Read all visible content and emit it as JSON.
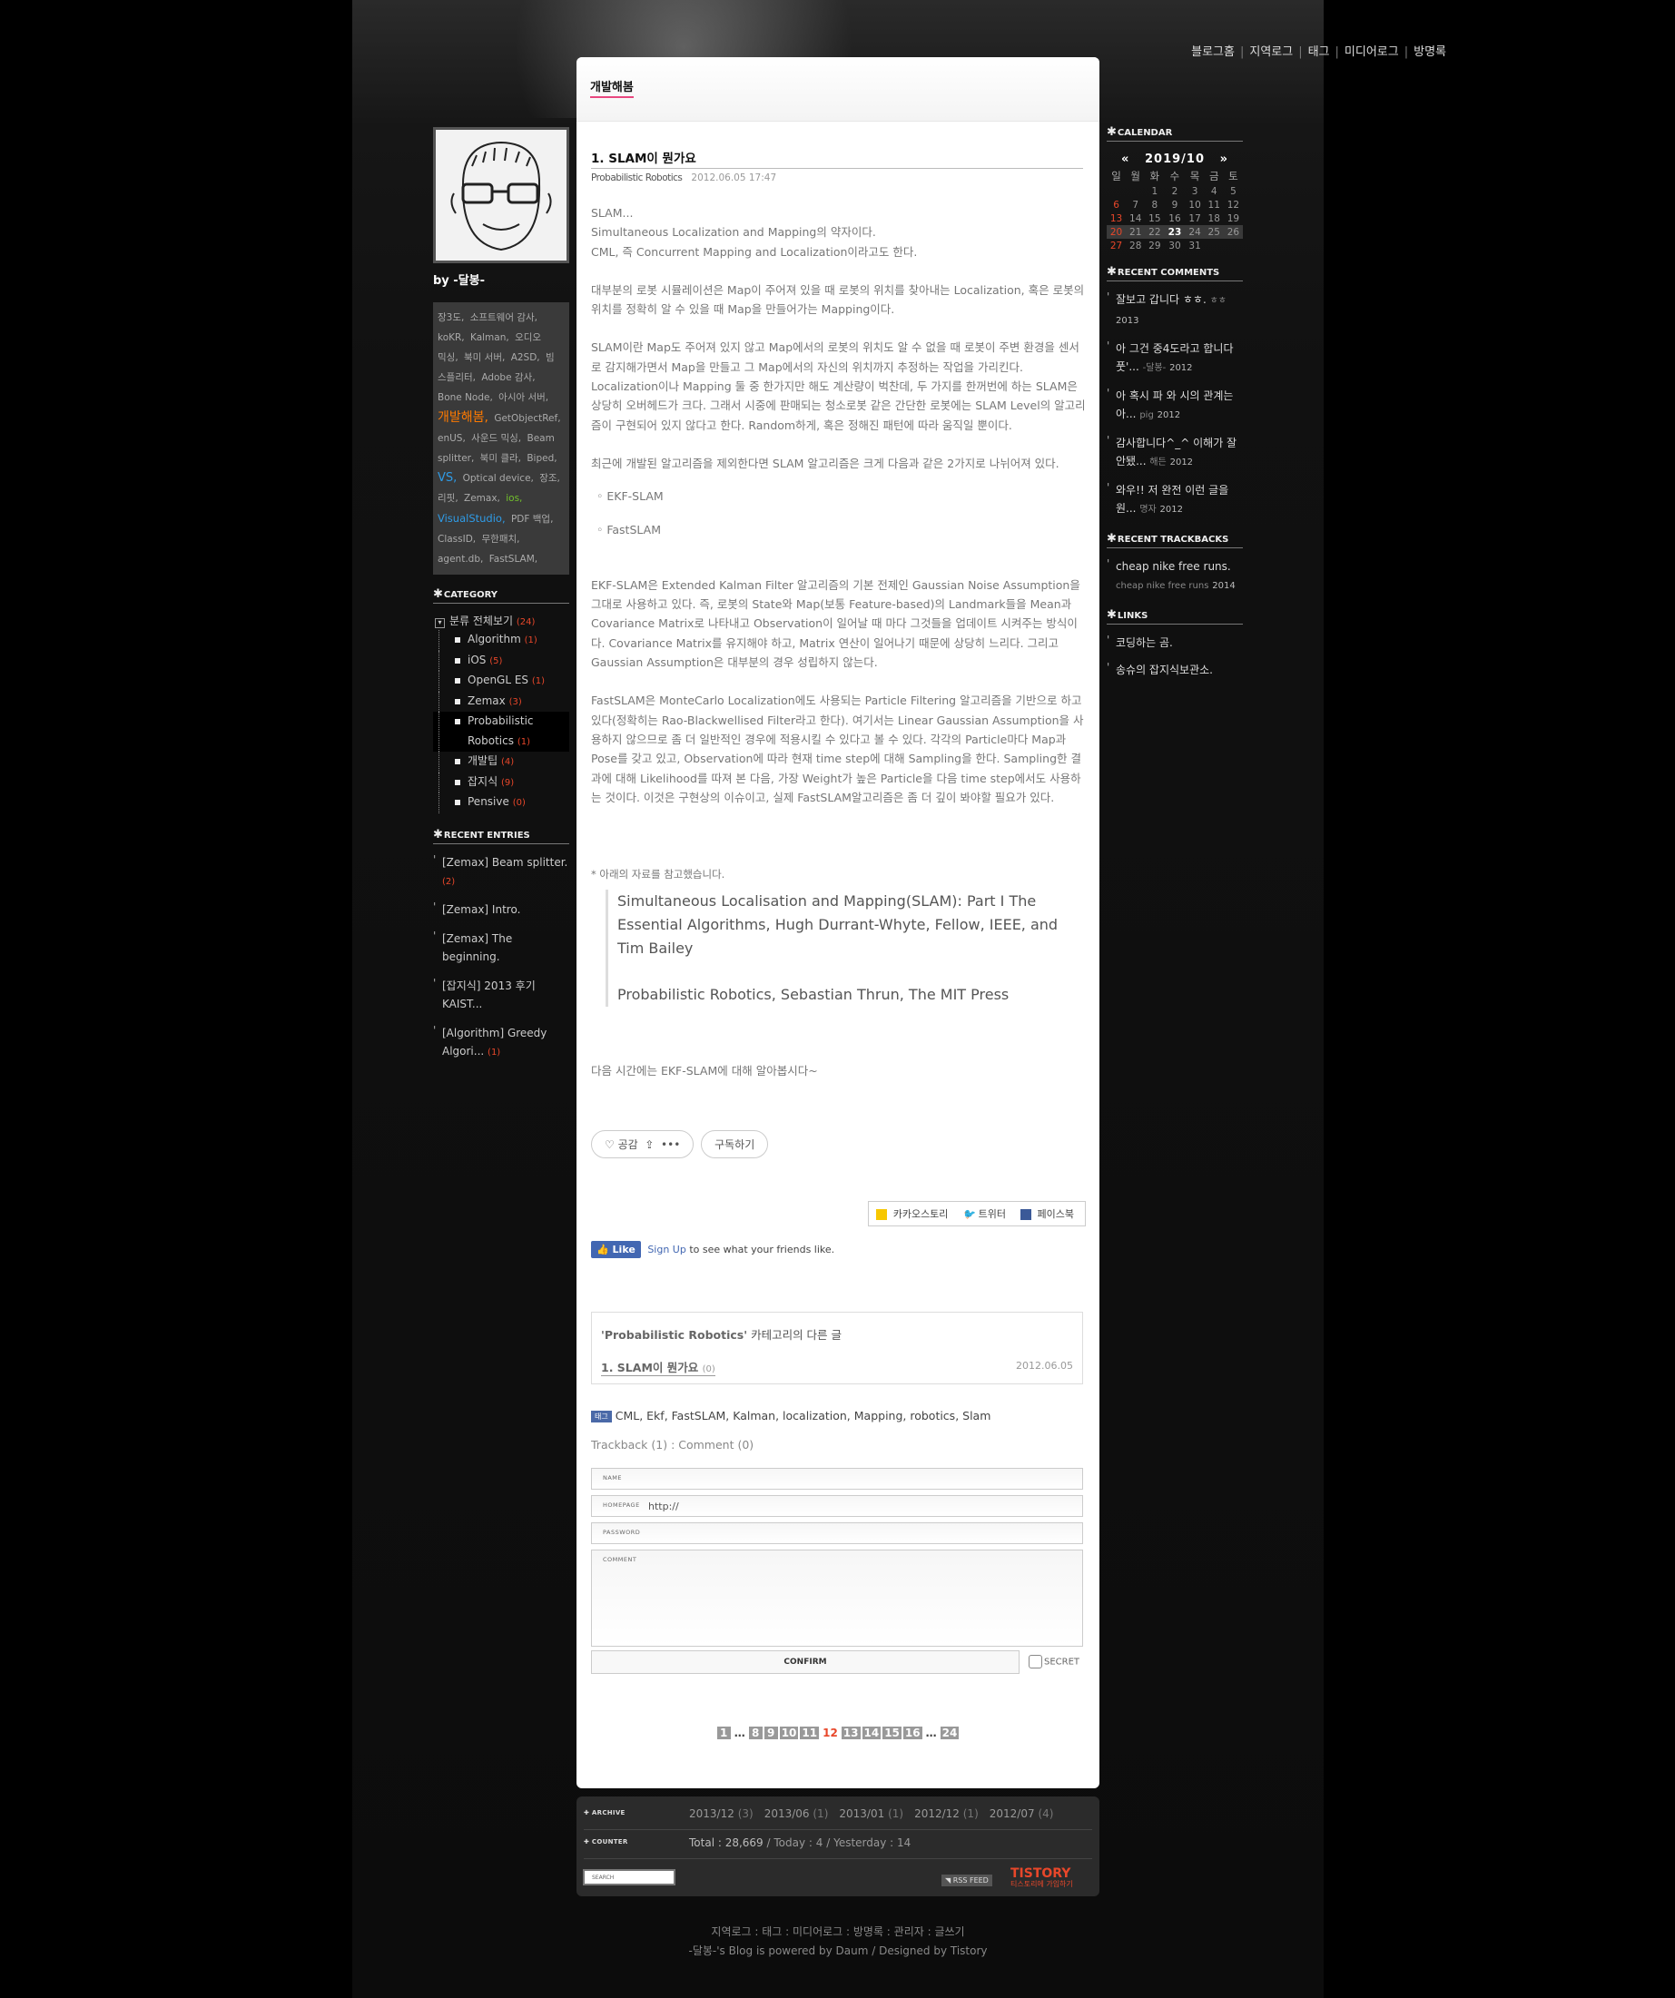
{
  "topnav": [
    "블로그홈",
    "지역로그",
    "태그",
    "미디어로그",
    "방명록"
  ],
  "sidebar_left": {
    "byline": "by -달봉-",
    "tags": [
      {
        "t": "장3도,",
        "s": ""
      },
      {
        "t": "소프트웨어 감사,",
        "s": ""
      },
      {
        "t": "koKR,",
        "s": ""
      },
      {
        "t": "Kalman,",
        "s": ""
      },
      {
        "t": "오디오 믹싱,",
        "s": ""
      },
      {
        "t": "북미 서버,",
        "s": ""
      },
      {
        "t": "A2SD,",
        "s": ""
      },
      {
        "t": "빔 스플리터,",
        "s": ""
      },
      {
        "t": "Adobe 감사,",
        "s": ""
      },
      {
        "t": "Bone Node,",
        "s": ""
      },
      {
        "t": "아시아 서버,",
        "s": ""
      },
      {
        "t": "개발해봄,",
        "s": "big"
      },
      {
        "t": "GetObjectRef,",
        "s": ""
      },
      {
        "t": "enUS,",
        "s": ""
      },
      {
        "t": "사운드 믹싱,",
        "s": ""
      },
      {
        "t": "Beam splitter,",
        "s": ""
      },
      {
        "t": "북미 클라,",
        "s": ""
      },
      {
        "t": "Biped,",
        "s": ""
      },
      {
        "t": "VS,",
        "s": "blue"
      },
      {
        "t": "Optical device,",
        "s": ""
      },
      {
        "t": "장조,",
        "s": ""
      },
      {
        "t": "리핏,",
        "s": ""
      },
      {
        "t": "Zemax,",
        "s": ""
      },
      {
        "t": "ios,",
        "s": "green"
      },
      {
        "t": "VisualStudio,",
        "s": "blue2"
      },
      {
        "t": "PDF 백업,",
        "s": ""
      },
      {
        "t": "ClassID,",
        "s": ""
      },
      {
        "t": "무한패치,",
        "s": ""
      },
      {
        "t": "agent.db,",
        "s": ""
      },
      {
        "t": "FastSLAM,",
        "s": ""
      }
    ],
    "category_title": "CATEGORY",
    "category_root": "분류 전체보기",
    "category_root_count": "(24)",
    "categories": [
      {
        "name": "Algorithm",
        "count": "(1)"
      },
      {
        "name": "iOS",
        "count": "(5)"
      },
      {
        "name": "OpenGL ES",
        "count": "(1)"
      },
      {
        "name": "Zemax",
        "count": "(3)"
      },
      {
        "name": "Probabilistic Robotics",
        "count": "(1)"
      },
      {
        "name": "개발팁",
        "count": "(4)"
      },
      {
        "name": "잡지식",
        "count": "(9)"
      },
      {
        "name": "Pensive",
        "count": "(0)"
      }
    ],
    "recent_entries_title": "RECENT ENTRIES",
    "recent_entries": [
      {
        "title": "[Zemax] Beam splitter.",
        "count": "(2)"
      },
      {
        "title": "[Zemax] Intro.",
        "count": ""
      },
      {
        "title": "[Zemax] The beginning.",
        "count": ""
      },
      {
        "title": "[잡지식] 2013 후기 KAIST...",
        "count": ""
      },
      {
        "title": "[Algorithm] Greedy Algori...",
        "count": "(1)"
      }
    ]
  },
  "sidebar_right": {
    "calendar_title": "CALENDAR",
    "cal_prev": "«",
    "cal_month": "2019/10",
    "cal_next": "»",
    "weekdays": [
      "일",
      "월",
      "화",
      "수",
      "목",
      "금",
      "토"
    ],
    "weeks": [
      [
        "",
        "",
        "1",
        "2",
        "3",
        "4",
        "5"
      ],
      [
        "6",
        "7",
        "8",
        "9",
        "10",
        "11",
        "12"
      ],
      [
        "13",
        "14",
        "15",
        "16",
        "17",
        "18",
        "19"
      ],
      [
        "20",
        "21",
        "22",
        "23",
        "24",
        "25",
        "26"
      ],
      [
        "27",
        "28",
        "29",
        "30",
        "31",
        "",
        ""
      ]
    ],
    "today": "23",
    "recent_comments_title": "RECENT COMMENTS",
    "recent_comments": [
      {
        "text": "잘보고 갑니다 ㅎㅎ.",
        "author": "ㅎㅎ",
        "year": "2013"
      },
      {
        "text": "아 그건 중4도라고 합니다 풋'...",
        "author": "-달봉-",
        "year": "2012"
      },
      {
        "text": "아 혹시 파 와 시의 관계는 아...",
        "author": "pig",
        "year": "2012"
      },
      {
        "text": "감사합니다^_^ 이해가 잘 안됐...",
        "author": "해든",
        "year": "2012"
      },
      {
        "text": "와우!! 저 완전 이런 글을 원...",
        "author": "명자",
        "year": "2012"
      }
    ],
    "recent_trackbacks_title": "RECENT TRACKBACKS",
    "recent_trackbacks": [
      {
        "text": "cheap nike free runs.",
        "author": "cheap nike free runs",
        "year": "2014"
      }
    ],
    "links_title": "LINKS",
    "links": [
      "코딩하는 곰.",
      "송슈의 잡지식보관소."
    ]
  },
  "post": {
    "blog_title": "개발해봄",
    "title": "1. SLAM이 뭔가요",
    "category": "Probabilistic Robotics",
    "date": "2012.06.05 17:47",
    "p1_1": "SLAM...",
    "p1_2": "Simultaneous Localization and Mapping의 약자이다.",
    "p1_3": "CML, 즉 Concurrent Mapping and Localization이라고도 한다.",
    "p2": "대부분의 로봇 시뮬레이션은 Map이 주어져 있을 때 로봇의 위치를 찾아내는 Localization, 혹은 로봇의 위치를 정확히 알 수 있을 때 Map을 만들어가는 Mapping이다.",
    "p3": "SLAM이란 Map도 주어져 있지 않고 Map에서의 로봇의 위치도 알 수 없을 때 로봇이 주변 환경을 센서로 감지해가면서 Map을 만들고 그 Map에서의 자신의 위치까지 추정하는 작업을 가리킨다. Localization이나 Mapping 둘 중 한가지만 해도 계산량이 벅찬데, 두 가지를 한꺼번에 하는 SLAM은 상당히 오버헤드가 크다. 그래서 시중에 판매되는 청소로봇 같은 간단한 로봇에는 SLAM Level의 알고리즘이 구현되어 있지 않다고 한다. Random하게, 혹은 정해진 패턴에 따라 움직일 뿐이다.",
    "p4": "최근에 개발된 알고리즘을 제외한다면 SLAM 알고리즘은 크게 다음과 같은 2가지로 나뉘어져 있다.",
    "li1": "◦ EKF-SLAM",
    "li2": "◦ FastSLAM",
    "p5": "EKF-SLAM은 Extended Kalman Filter 알고리즘의 기본 전제인 Gaussian Noise Assumption을 그대로 사용하고 있다. 즉, 로봇의 State와 Map(보통 Feature-based)의 Landmark들을 Mean과 Covariance Matrix로 나타내고 Observation이 일어날 때 마다 그것들을 업데이트 시켜주는 방식이다. Covariance Matrix를 유지해야 하고, Matrix 연산이 일어나기 때문에 상당히 느리다. 그리고 Gaussian Assumption은 대부분의 경우 성립하지 않는다.",
    "p6": "FastSLAM은 MonteCarlo Localization에도 사용되는 Particle Filtering 알고리즘을 기반으로 하고 있다(정확히는 Rao-Blackwellised Filter라고 한다). 여기서는 Linear Gaussian Assumption을 사용하지 않으므로 좀 더 일반적인 경우에 적용시킬 수 있다고 볼 수 있다. 각각의 Particle마다 Map과 Pose를 갖고 있고, Observation에 따라 현재 time step에 대해 Sampling을 한다. Sampling한 결과에 대해 Likelihood를 따져 본 다음, 가장 Weight가 높은 Particle을 다음 time step에서도 사용하는 것이다. 이것은 구현상의 이슈이고, 실제 FastSLAM알고리즘은 좀 더 깊이 봐야할 필요가 있다.",
    "ref_intro": "* 아래의 자료를 참고했습니다.",
    "ref1": "Simultaneous Localisation and Mapping(SLAM): Part I The Essential Algorithms, Hugh Durrant-Whyte, Fellow, IEEE, and Tim Bailey",
    "ref2": "Probabilistic Robotics, Sebastian Thrun, The MIT Press",
    "p7": "다음 시간에는 EKF-SLAM에 대해 알아봅시다~",
    "like_label": "공감",
    "subscribe_label": "구독하기",
    "share": {
      "kakao": "카카오스토리",
      "twitter": "트위터",
      "facebook": "페이스북"
    },
    "fb_like": "Like",
    "fb_signup": "Sign Up",
    "fb_text": "to see what your friends like.",
    "related_cat": "'Probabilistic Robotics'",
    "related_suffix": "카테고리의 다른 글",
    "related_title": "1. SLAM이 뭔가요",
    "related_count": "(0)",
    "related_date": "2012.06.05",
    "tags": "CML, Ekf, FastSLAM, Kalman, localization, Mapping, robotics, Slam",
    "trackback_comment": "Trackback (1) : Comment (0)"
  },
  "form": {
    "name_label": "NAME",
    "homepage_label": "HOMEPAGE",
    "homepage_value": "http://",
    "password_label": "PASSWORD",
    "comment_label": "COMMENT",
    "confirm_label": "CONFIRM",
    "secret_label": "SECRET"
  },
  "pager": [
    "1",
    "…",
    "8",
    "9",
    "10",
    "11",
    "12",
    "13",
    "14",
    "15",
    "16",
    "…",
    "24"
  ],
  "pager_current": "12",
  "footer": {
    "archive_label": "ARCHIVE",
    "archives": [
      {
        "m": "2013/12",
        "c": "(3)"
      },
      {
        "m": "2013/06",
        "c": "(1)"
      },
      {
        "m": "2013/01",
        "c": "(1)"
      },
      {
        "m": "2012/12",
        "c": "(1)"
      },
      {
        "m": "2012/07",
        "c": "(4)"
      }
    ],
    "counter_label": "COUNTER",
    "total": "Total : 28,669",
    "today": "/ Today : 4",
    "yesterday": "/ Yesterday : 14",
    "search_placeholder": "SEARCH",
    "rss": "RSS FEED",
    "tistory": "TISTORY",
    "tistory_sub": "티스토리에 가입하기"
  },
  "bottom": {
    "links": "지역로그 : 태그 : 미디어로그 : 방명록 : 관리자 : 글쓰기",
    "powered": "-달봉-'s Blog is powered by Daum / Designed by Tistory"
  },
  "colors": {
    "accent_pink": "#e8477f",
    "count_red": "#e8472a",
    "tag_orange": "#ff7a00",
    "tag_blue": "#2f9be6"
  }
}
